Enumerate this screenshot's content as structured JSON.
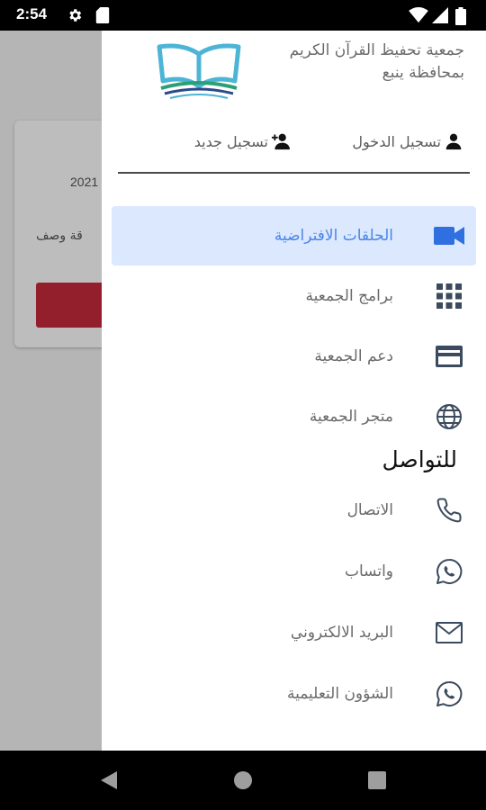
{
  "status_bar": {
    "time": "2:54"
  },
  "background_screen": {
    "year_text": "2021",
    "description_text": "قة وصف"
  },
  "drawer": {
    "org_name": "جمعية تحفيظ القرآن الكريم بمحافظة ينبع",
    "auth": {
      "login_label": "تسجيل الدخول",
      "register_label": "تسجيل جديد"
    },
    "menu": [
      {
        "label": "الحلقات الافتراضية",
        "icon": "video-camera-icon",
        "active": true
      },
      {
        "label": "برامج الجمعية",
        "icon": "grid-apps-icon",
        "active": false
      },
      {
        "label": "دعم الجمعية",
        "icon": "credit-card-icon",
        "active": false
      },
      {
        "label": "متجر الجمعية",
        "icon": "globe-icon",
        "active": false
      }
    ],
    "contact_title": "للتواصل",
    "contact": [
      {
        "label": "الاتصال",
        "icon": "phone-icon"
      },
      {
        "label": "واتساب",
        "icon": "whatsapp-icon"
      },
      {
        "label": "البريد الالكتروني",
        "icon": "email-icon"
      },
      {
        "label": "الشؤون التعليمية",
        "icon": "whatsapp-icon"
      }
    ]
  },
  "colors": {
    "active_bg": "#dce8fd",
    "active_text": "#4b86e8",
    "icon_dark": "#3b4a5e",
    "background_button": "#c82a3c"
  }
}
